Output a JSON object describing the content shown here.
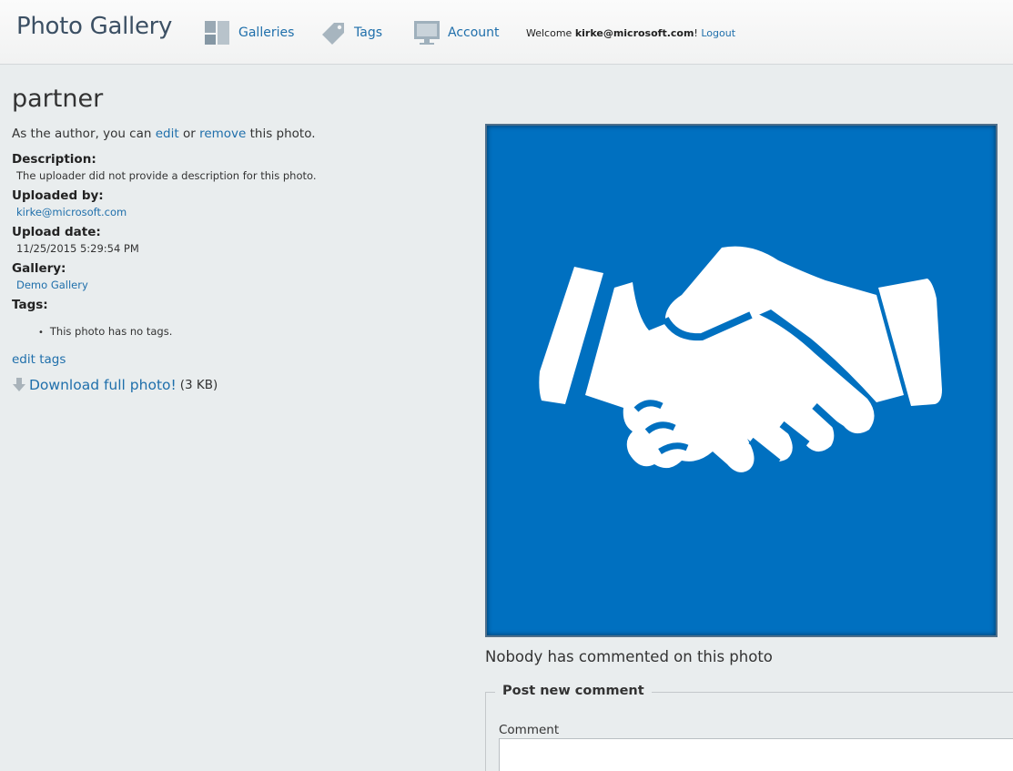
{
  "header": {
    "site_title": "Photo Gallery",
    "nav": [
      {
        "label": "Galleries",
        "icon": "galleries-icon"
      },
      {
        "label": "Tags",
        "icon": "tag-icon"
      },
      {
        "label": "Account",
        "icon": "monitor-icon"
      }
    ],
    "welcome_prefix": "Welcome",
    "user_email": "kirke@microsoft.com",
    "welcome_suffix": "!",
    "logout_label": "Logout"
  },
  "photo": {
    "title": "partner",
    "author_prefix": "As the author, you can",
    "edit_label": "edit",
    "or_text": "or",
    "remove_label": "remove",
    "author_suffix": "this photo.",
    "description_label": "Description:",
    "description": "The uploader did not provide a description for this photo.",
    "uploaded_by_label": "Uploaded by:",
    "uploaded_by": "kirke@microsoft.com",
    "upload_date_label": "Upload date:",
    "upload_date": "11/25/2015 5:29:54 PM",
    "gallery_label": "Gallery:",
    "gallery": "Demo Gallery",
    "tags_label": "Tags:",
    "no_tags": "This photo has no tags.",
    "edit_tags_label": "edit tags",
    "download_label": "Download full photo!",
    "download_size": "(3 KB)",
    "image_icon": "handshake-icon",
    "image_bg_color": "#0070c0"
  },
  "comments": {
    "empty_text": "Nobody has commented on this photo",
    "post_legend": "Post new comment",
    "comment_label": "Comment",
    "comment_value": ""
  },
  "colors": {
    "link": "#1f6fab",
    "background": "#e9edee",
    "title": "#3c5064"
  }
}
